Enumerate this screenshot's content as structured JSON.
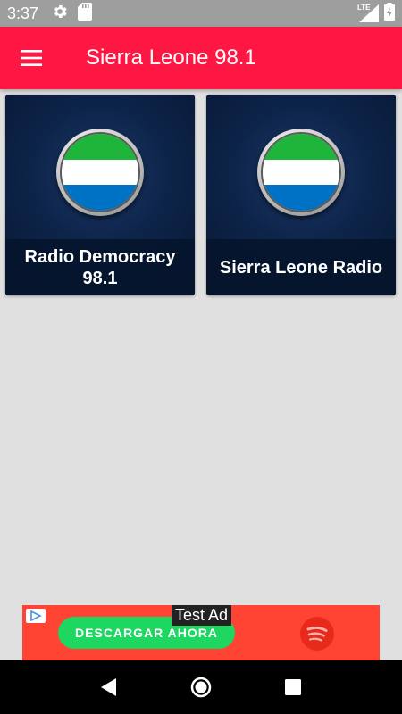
{
  "status_bar": {
    "time": "3:37",
    "network_label": "LTE"
  },
  "app_bar": {
    "title": "Sierra Leone 98.1"
  },
  "stations": [
    {
      "name": "Radio Democracy 98.1",
      "flag_colors": [
        "#1eb53a",
        "#ffffff",
        "#0072c6"
      ]
    },
    {
      "name": "Sierra Leone Radio",
      "flag_colors": [
        "#1eb53a",
        "#ffffff",
        "#0072c6"
      ]
    }
  ],
  "ad": {
    "label": "Test Ad",
    "cta": "DESCARGAR AHORA",
    "background_color": "#ff4433",
    "cta_color": "#1ed760"
  },
  "colors": {
    "accent": "#ff1744",
    "status_bar": "#9e9e9e",
    "background": "#e0e0e0"
  }
}
